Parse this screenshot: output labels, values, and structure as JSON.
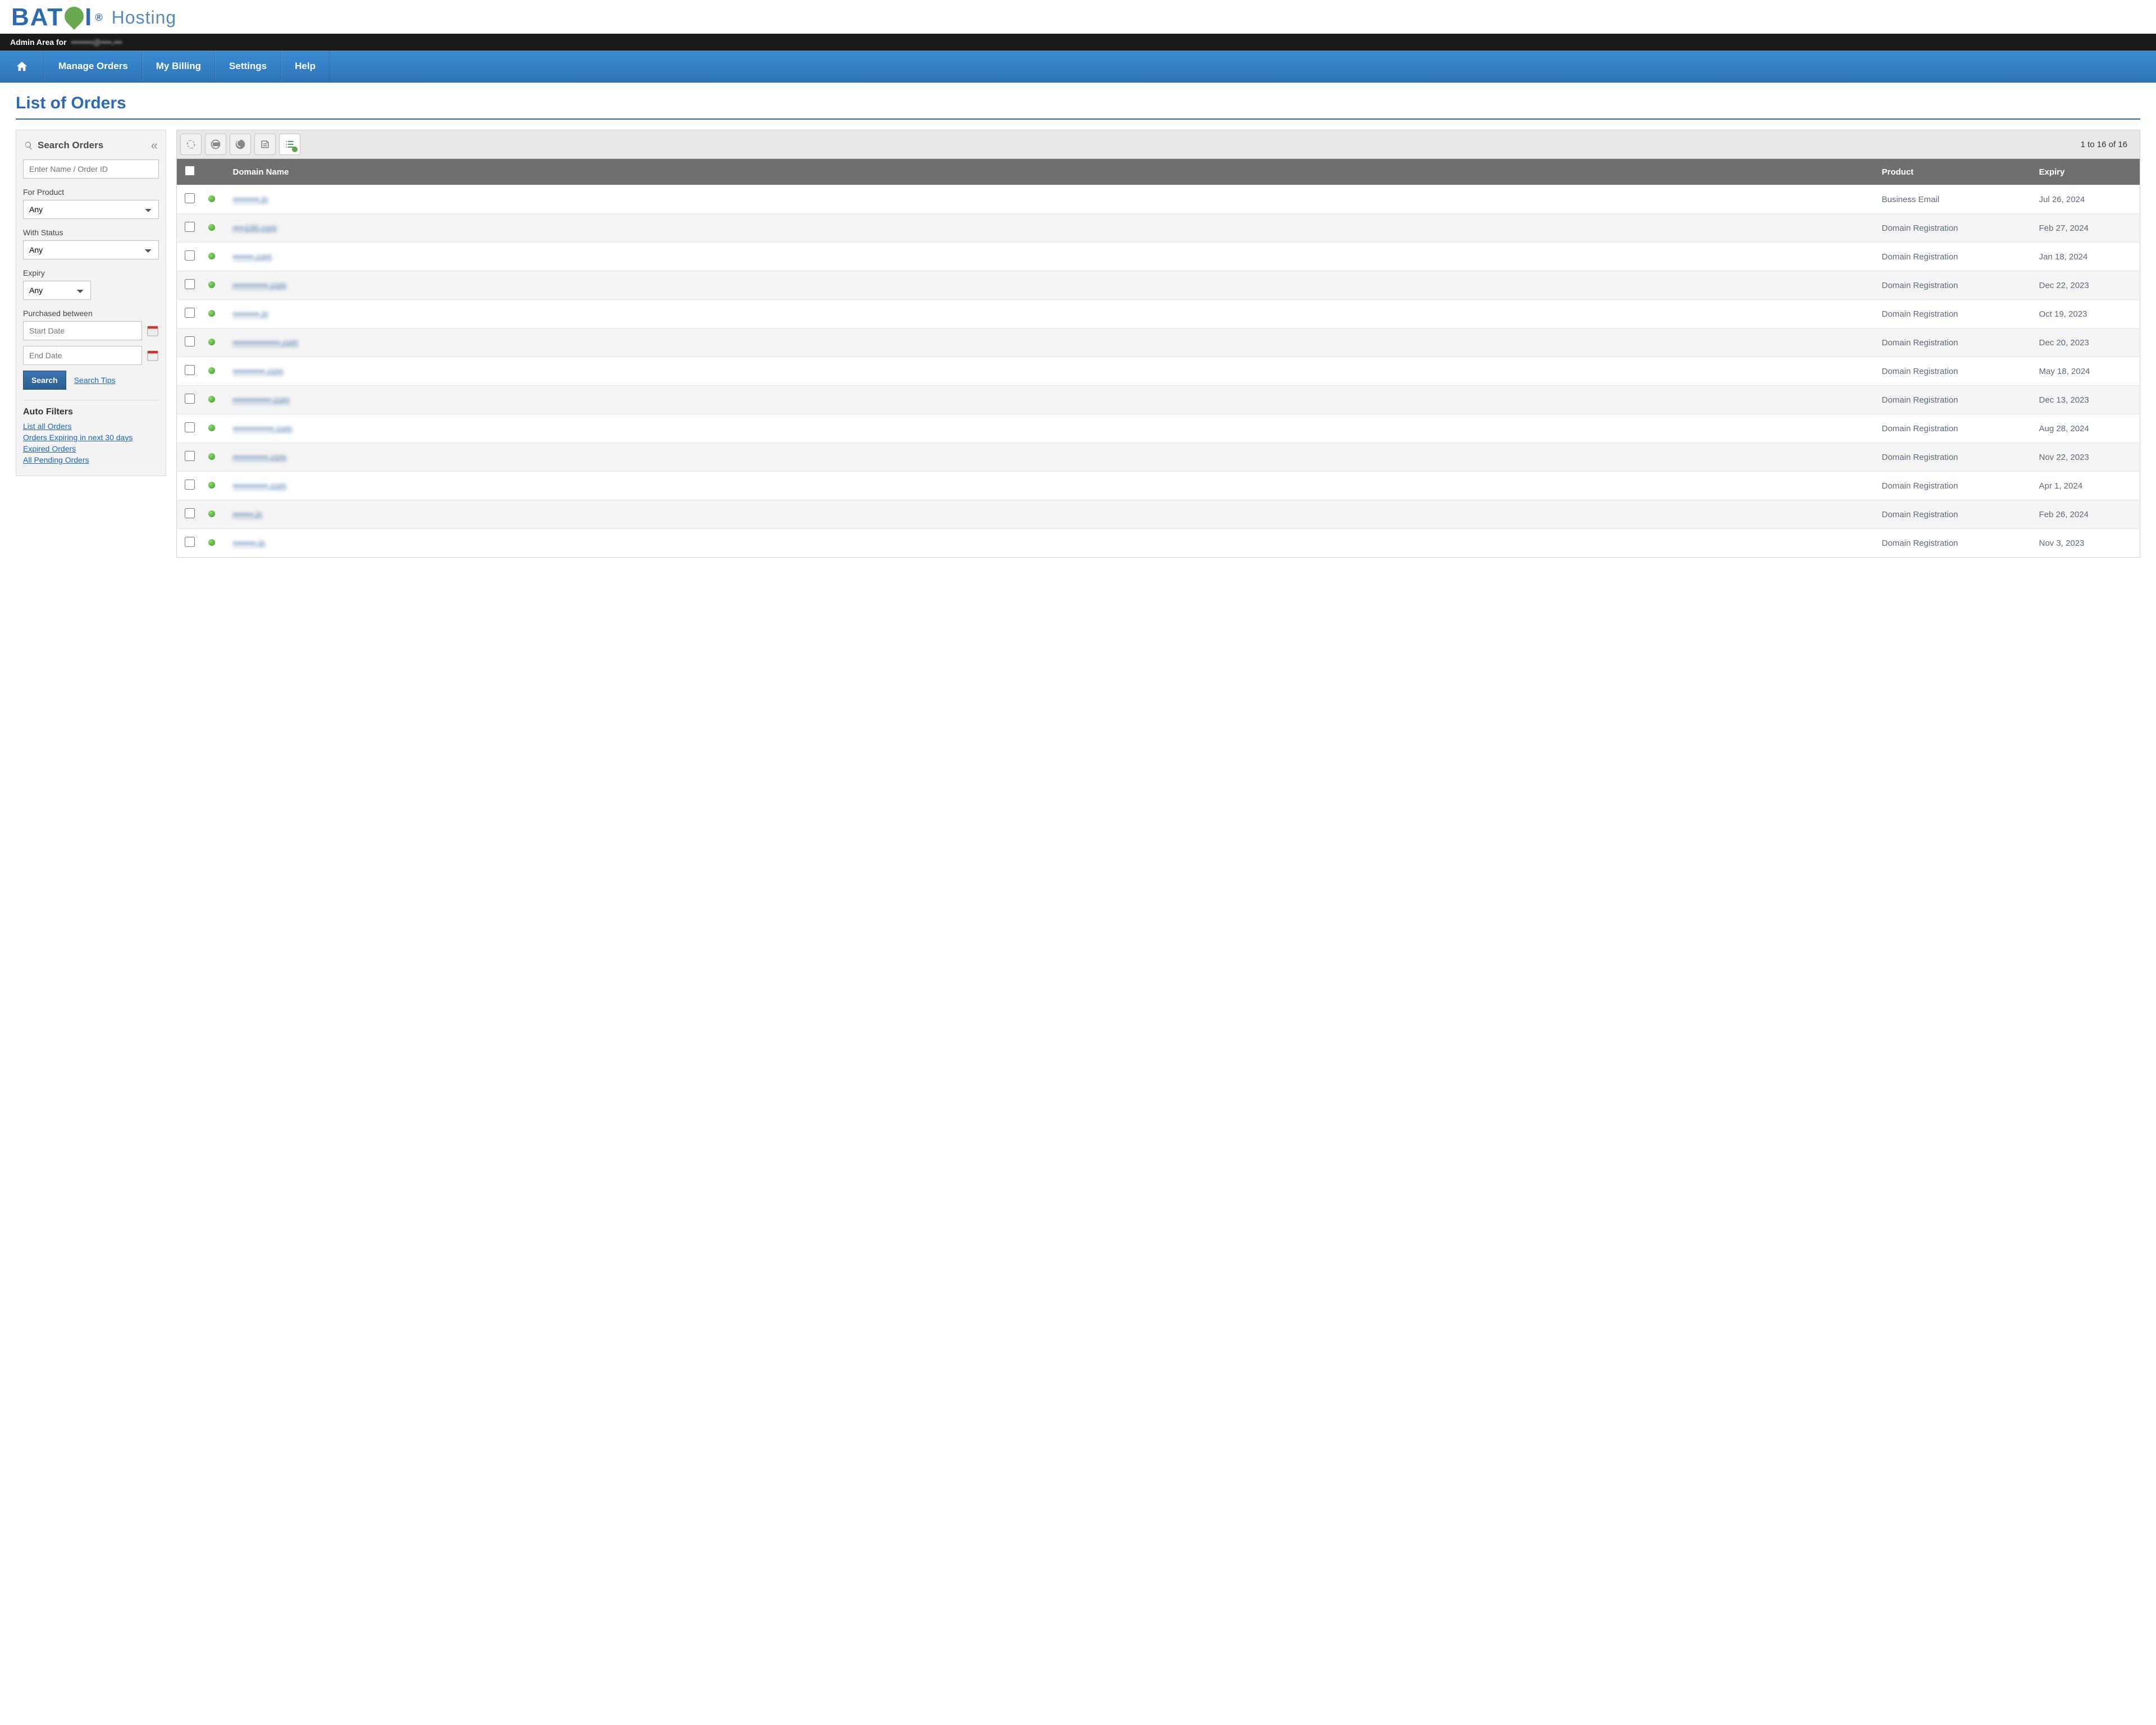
{
  "brand": {
    "name": "BAT I",
    "suffix": "Hosting"
  },
  "admin_bar": {
    "prefix": "Admin Area for",
    "account": "••••••••@••••.•••"
  },
  "nav": {
    "items": [
      {
        "label": "Manage Orders"
      },
      {
        "label": "My Billing"
      },
      {
        "label": "Settings"
      },
      {
        "label": "Help"
      }
    ]
  },
  "page": {
    "title": "List of Orders"
  },
  "search_panel": {
    "title": "Search Orders",
    "name_placeholder": "Enter Name / Order ID",
    "for_product_label": "For Product",
    "for_product_value": "Any",
    "with_status_label": "With Status",
    "with_status_value": "Any",
    "expiry_label": "Expiry",
    "expiry_value": "Any",
    "purchased_label": "Purchased between",
    "start_placeholder": "Start Date",
    "end_placeholder": "End Date",
    "search_button": "Search",
    "search_tips": "Search Tips",
    "auto_filters_title": "Auto Filters",
    "auto_filters": [
      "List all Orders",
      "Orders Expiring in next 30 days",
      "Expired Orders",
      "All Pending Orders"
    ]
  },
  "toolbar": {
    "paging": "1 to 16 of 16"
  },
  "table": {
    "headers": {
      "domain": "Domain Name",
      "product": "Product",
      "expiry": "Expiry"
    },
    "rows": [
      {
        "domain": "•••••••••.in",
        "product": "Business Email",
        "expiry": "Jul 26, 2024"
      },
      {
        "domain": "••••100.com",
        "product": "Domain Registration",
        "expiry": "Feb 27, 2024"
      },
      {
        "domain": "•••••••.com",
        "product": "Domain Registration",
        "expiry": "Jan 18, 2024"
      },
      {
        "domain": "••••••••••••.com",
        "product": "Domain Registration",
        "expiry": "Dec 22, 2023"
      },
      {
        "domain": "•••••••••.in",
        "product": "Domain Registration",
        "expiry": "Oct 19, 2023"
      },
      {
        "domain": "••••••••••••••••.com",
        "product": "Domain Registration",
        "expiry": "Dec 20, 2023"
      },
      {
        "domain": "•••••••••••.com",
        "product": "Domain Registration",
        "expiry": "May 18, 2024"
      },
      {
        "domain": "•••••••••••••.com",
        "product": "Domain Registration",
        "expiry": "Dec 13, 2023"
      },
      {
        "domain": "••••••••••••••.com",
        "product": "Domain Registration",
        "expiry": "Aug 28, 2024"
      },
      {
        "domain": "••••••••••••.com",
        "product": "Domain Registration",
        "expiry": "Nov 22, 2023"
      },
      {
        "domain": "••••••••••••.com",
        "product": "Domain Registration",
        "expiry": "Apr 1, 2024"
      },
      {
        "domain": "•••••••.in",
        "product": "Domain Registration",
        "expiry": "Feb 26, 2024"
      },
      {
        "domain": "••••••••.in",
        "product": "Domain Registration",
        "expiry": "Nov 3, 2023"
      }
    ]
  }
}
